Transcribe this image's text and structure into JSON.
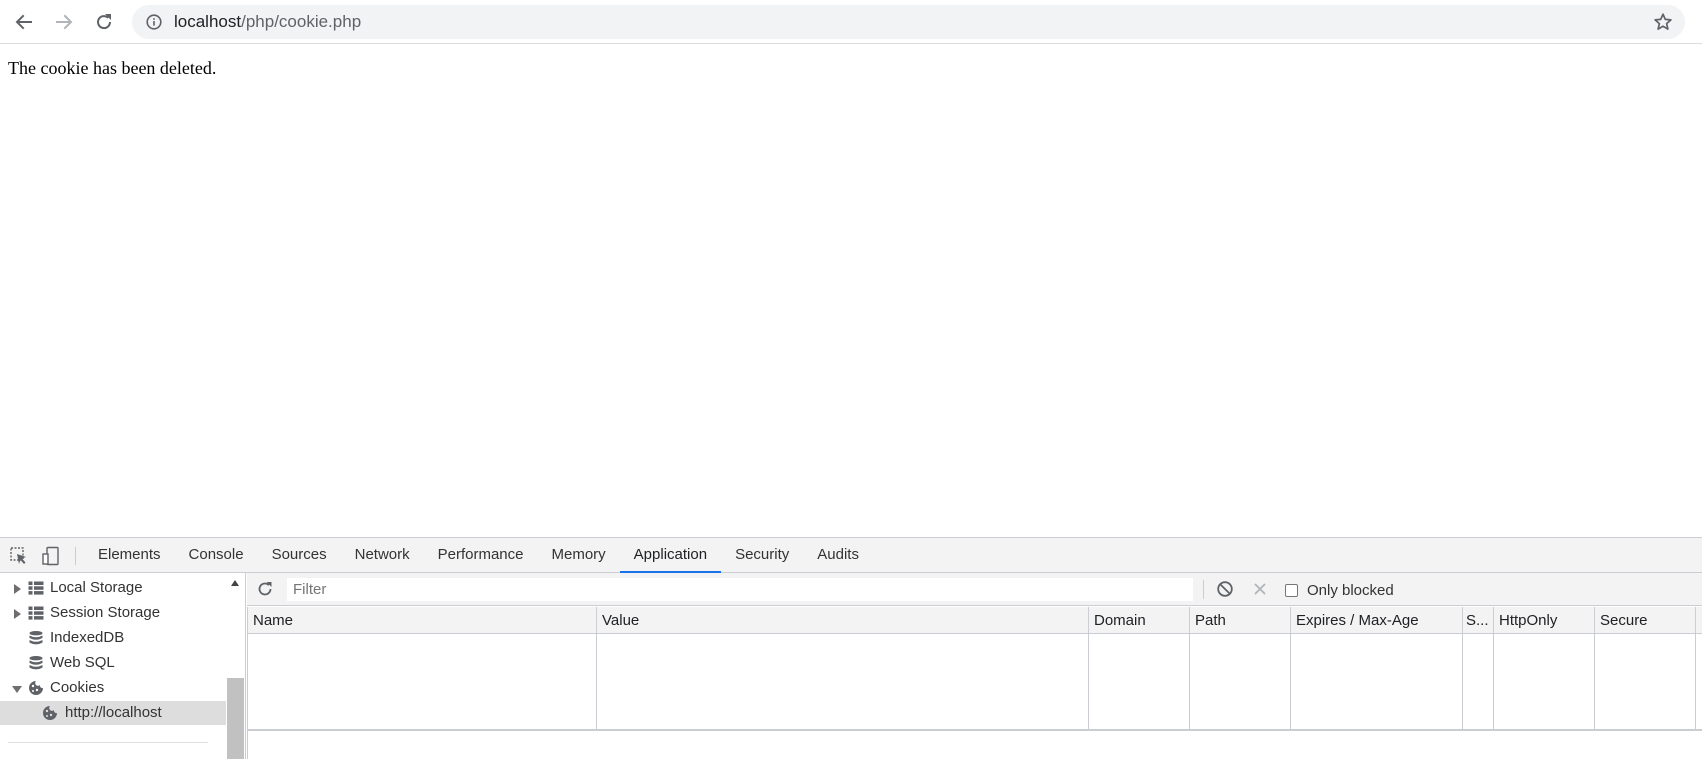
{
  "browser": {
    "url_host": "localhost",
    "url_path": "/php/cookie.php",
    "icons": {
      "back": "arrow-left-icon",
      "forward": "arrow-right-icon",
      "reload": "reload-icon",
      "site_info": "info-icon",
      "bookmark": "star-icon"
    }
  },
  "page": {
    "message": "The cookie has been deleted."
  },
  "devtools": {
    "tabs": [
      "Elements",
      "Console",
      "Sources",
      "Network",
      "Performance",
      "Memory",
      "Application",
      "Security",
      "Audits"
    ],
    "active_tab": "Application",
    "sidebar": {
      "items": [
        {
          "label": "Local Storage",
          "icon": "grid-icon",
          "expandable": true,
          "expanded": false
        },
        {
          "label": "Session Storage",
          "icon": "grid-icon",
          "expandable": true,
          "expanded": false
        },
        {
          "label": "IndexedDB",
          "icon": "database-icon",
          "expandable": false
        },
        {
          "label": "Web SQL",
          "icon": "database-icon",
          "expandable": false
        },
        {
          "label": "Cookies",
          "icon": "cookie-icon",
          "expandable": true,
          "expanded": true
        },
        {
          "label": "http://localhost",
          "icon": "cookie-icon",
          "selected": true
        }
      ]
    },
    "cookies": {
      "filter_placeholder": "Filter",
      "filter_value": "",
      "only_blocked_label": "Only blocked",
      "only_blocked_checked": false,
      "columns": [
        "Name",
        "Value",
        "Domain",
        "Path",
        "Expires / Max-Age",
        "S...",
        "HttpOnly",
        "Secure"
      ],
      "rows": []
    }
  }
}
